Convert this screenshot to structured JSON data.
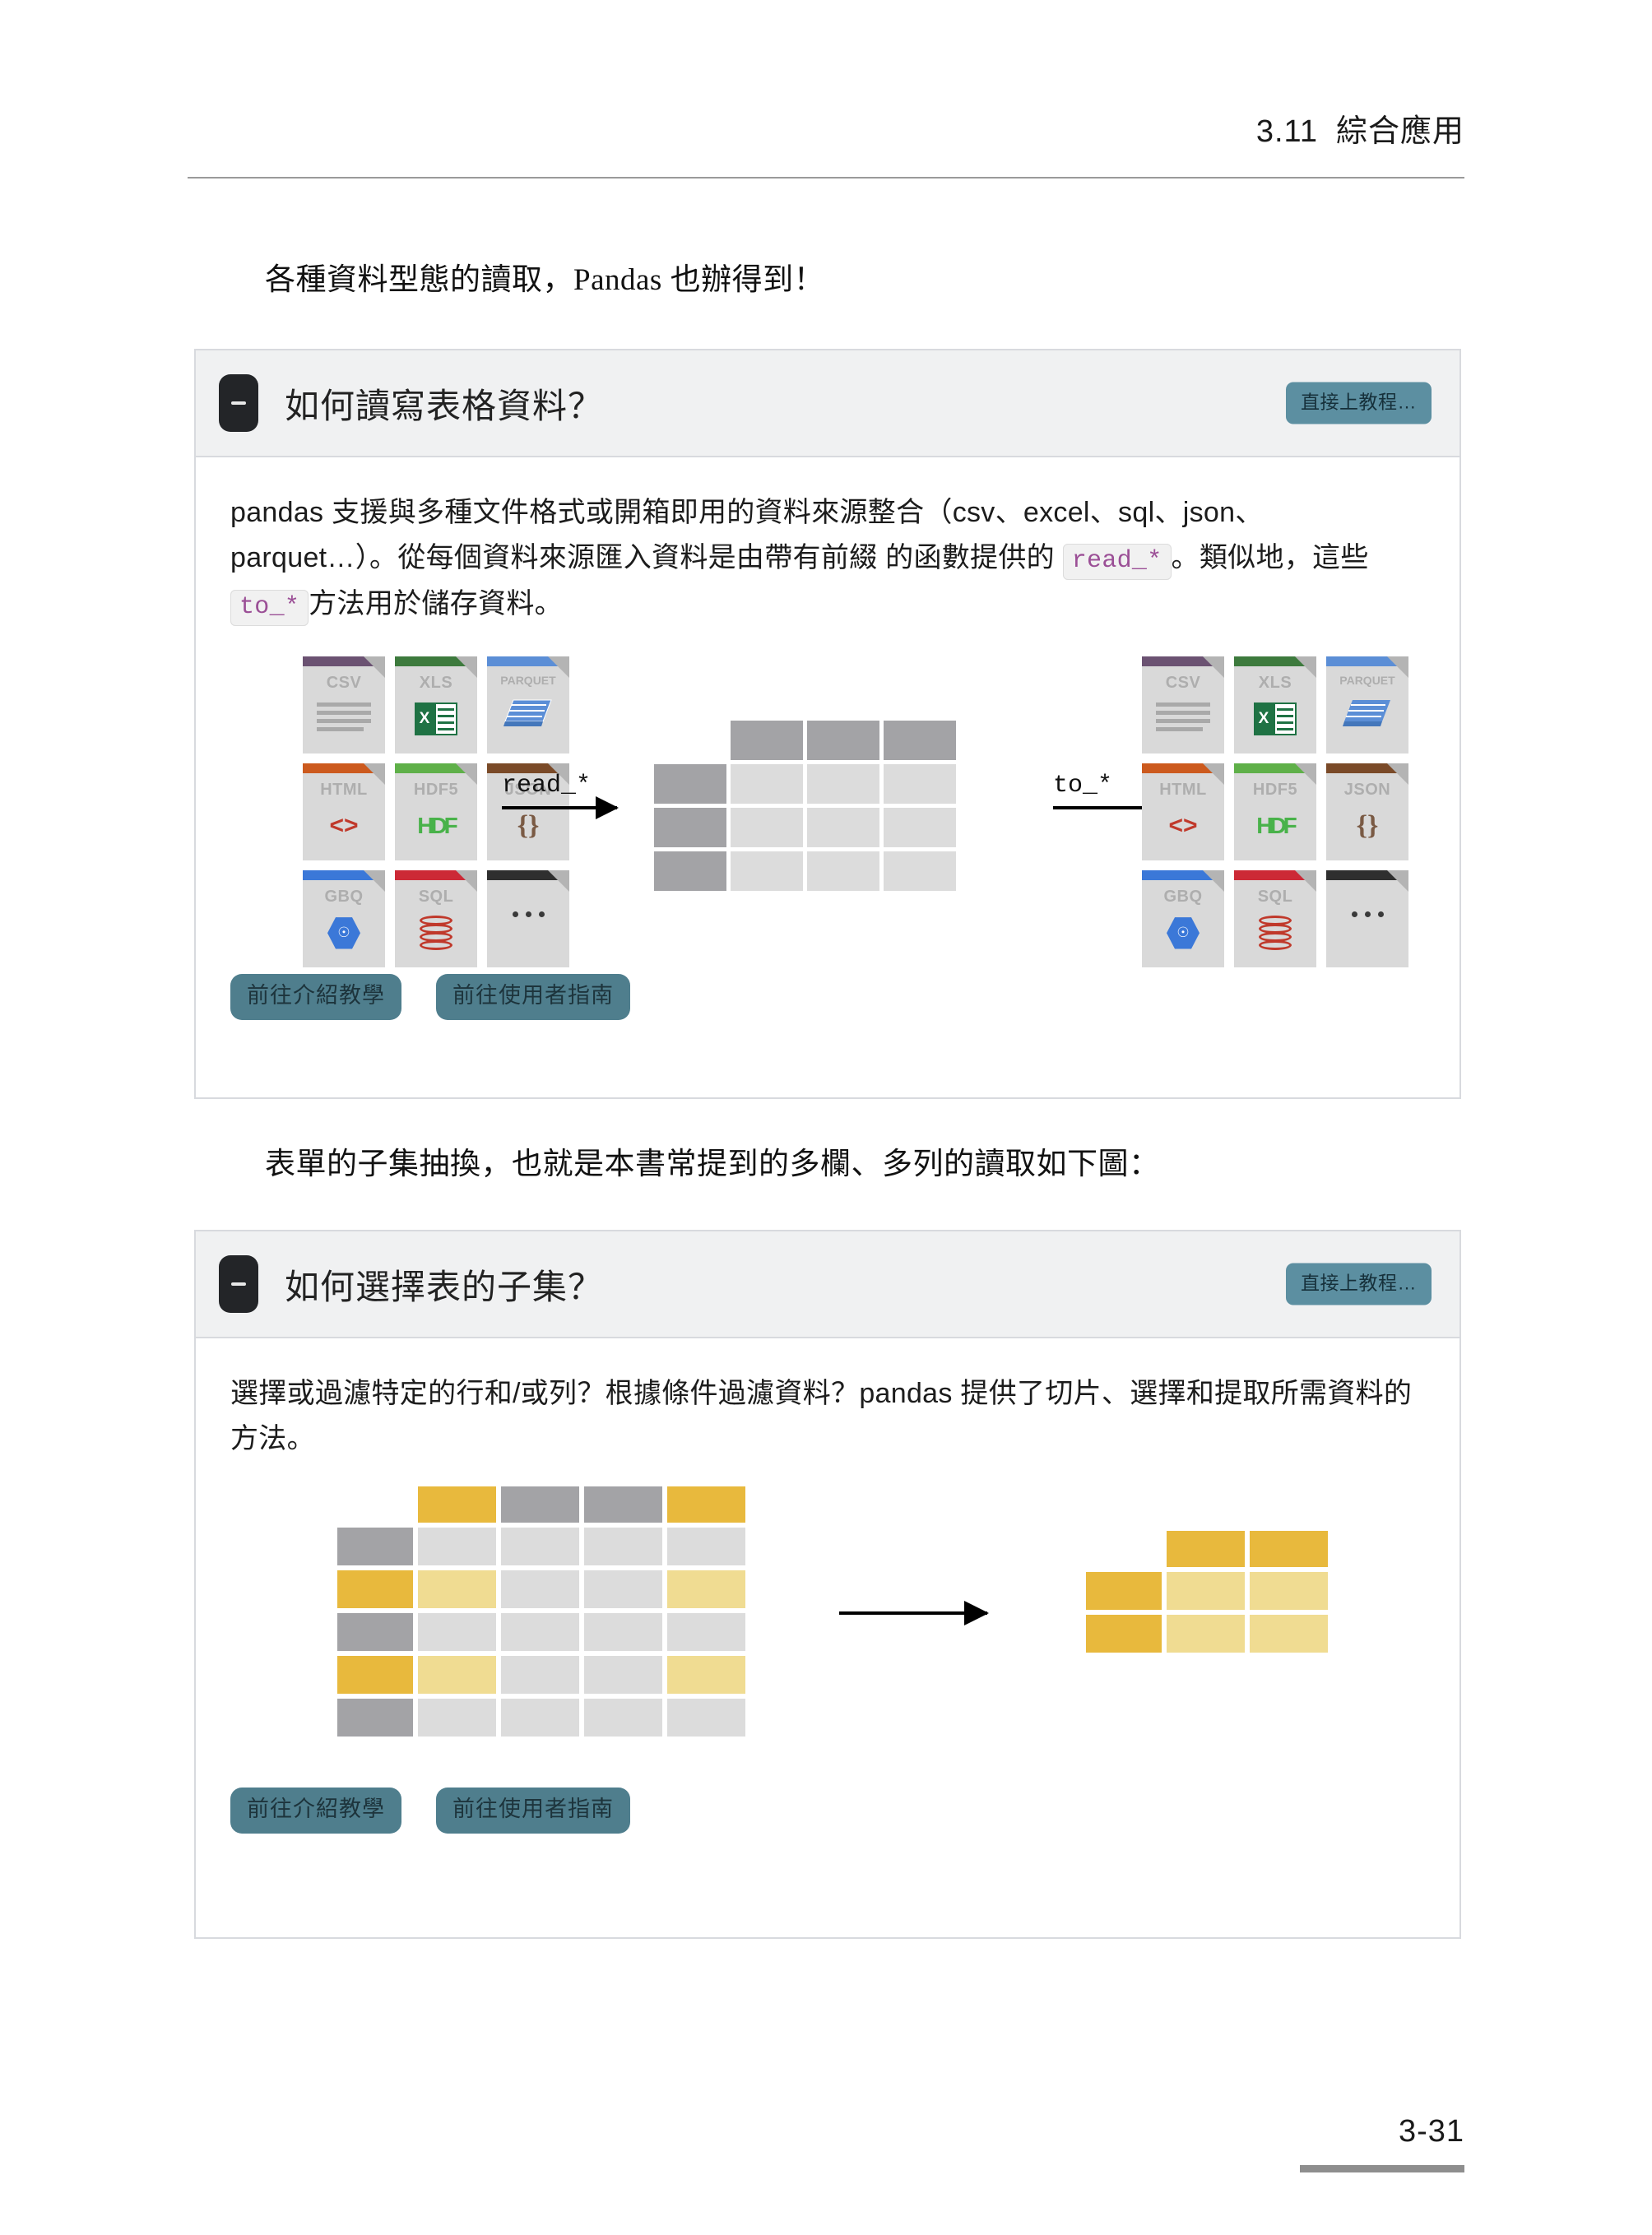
{
  "page": {
    "running_head": {
      "section": "3.11",
      "title": "綜合應用"
    },
    "page_number": "3-31"
  },
  "paragraphs": {
    "intro": "各種資料型態的讀取，Pandas 也辦得到！",
    "between": "表單的子集抽換，也就是本書常提到的多欄、多列的讀取如下圖："
  },
  "cards": [
    {
      "title": "如何讀寫表格資料？",
      "collapse_icon": "minus-icon",
      "tutorial_button": "直接上教程…",
      "body_parts": {
        "t1": "pandas 支援與多種文件格式或開箱即用的資料來源整合（csv、excel、sql、json、parquet…）。從每個資料來源匯入資料是由帶有前綴 的函數提供的 ",
        "code1": "read_*",
        "t2": "。類似地，這些 ",
        "code2": "to_*",
        "t3": "方法用於儲存資料。"
      },
      "actions": [
        "前往介紹教學",
        "前往使用者指南"
      ],
      "figure": {
        "type": "io-diagram",
        "read_label": "read_*",
        "write_label": "to_*",
        "file_icons": [
          {
            "name": "CSV",
            "color": "#6b5272",
            "glyph": "csv-lines"
          },
          {
            "name": "XLS",
            "color": "#3d7a3d",
            "glyph": "excel-sheet"
          },
          {
            "name": "PARQUET",
            "color": "#5b8ed6",
            "glyph": "parquet-stack"
          },
          {
            "name": "HTML",
            "color": "#cc5a1e",
            "glyph": "angle-brackets"
          },
          {
            "name": "HDF5",
            "color": "#5fb049",
            "glyph": "hdf-logo"
          },
          {
            "name": "JSON",
            "color": "#7a4a28",
            "glyph": "curly-braces"
          },
          {
            "name": "GBQ",
            "color": "#3b78d8",
            "glyph": "bigquery-hex"
          },
          {
            "name": "SQL",
            "color": "#cc2936",
            "glyph": "database-cylinder"
          },
          {
            "name": "",
            "color": "#2f2f2f",
            "glyph": "ellipsis-dots"
          }
        ],
        "table": {
          "columns": 3,
          "rows": 3,
          "header_color": "#a3a3a6",
          "index_color": "#a3a3a6",
          "data_color": "#dcdcdc"
        }
      }
    },
    {
      "title": "如何選擇表的子集？",
      "collapse_icon": "minus-icon",
      "tutorial_button": "直接上教程…",
      "body_parts": {
        "t1": "選擇或過濾特定的行和/或列？根據條件過濾資料？pandas 提供了切片、選擇和提取所需資料的方法。"
      },
      "actions": [
        "前往介紹教學",
        "前往使用者指南"
      ],
      "figure": {
        "type": "subset-diagram",
        "source_table": {
          "columns": 4,
          "rows": 5,
          "selected_columns": [
            0,
            3
          ],
          "selected_rows": [
            1,
            3
          ],
          "colors": {
            "header_unselected": "#a3a3a6",
            "header_selected": "#e8b93d",
            "index_unselected": "#a3a3a6",
            "index_selected": "#e8b93d",
            "data_unselected": "#dcdcdc",
            "data_selected": "#f0dc92"
          }
        },
        "result_table": {
          "columns": 2,
          "rows": 2
        }
      }
    }
  ],
  "colors": {
    "card_border": "#d8dade",
    "card_header_bg": "#f0f1f2",
    "tutorial_button_bg": "#5c8fa1",
    "action_button_bg": "#4f7e8d",
    "code_text": "#9b4f96",
    "code_bg": "#f1f1f1"
  }
}
